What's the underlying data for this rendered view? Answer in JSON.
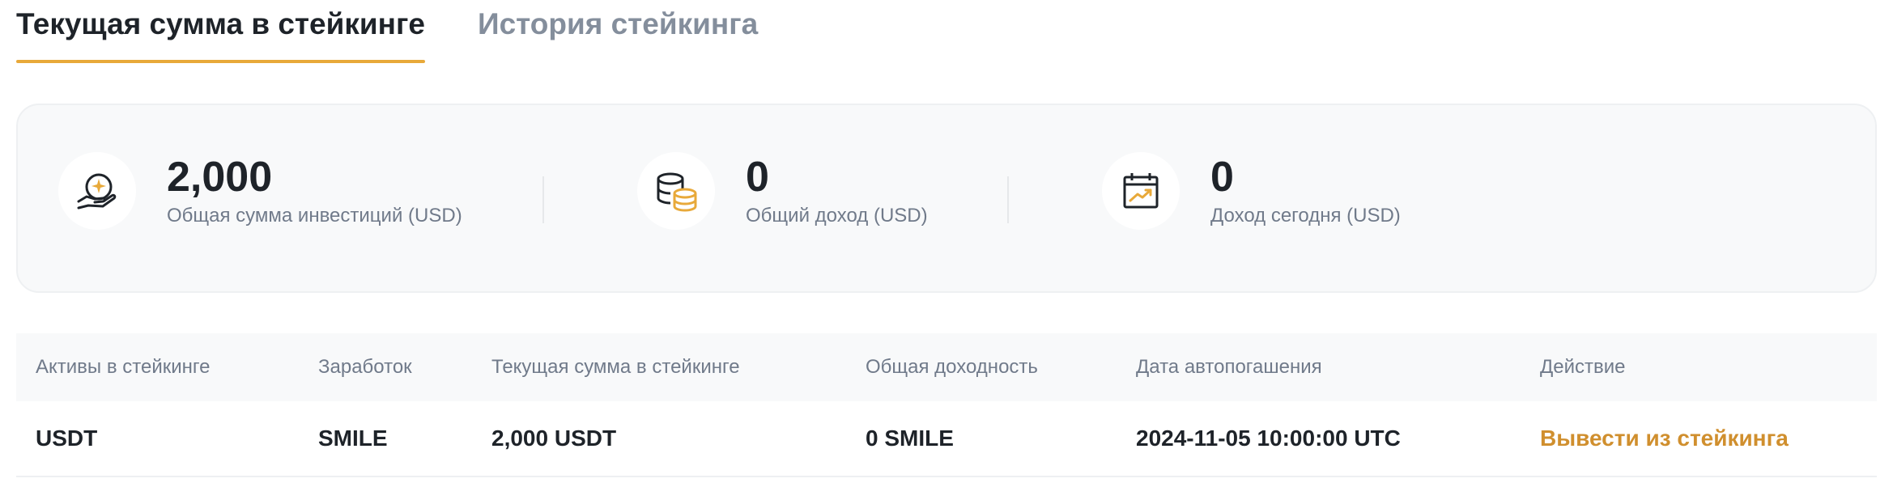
{
  "tabs": [
    {
      "label": "Текущая сумма в стейкинге",
      "active": true
    },
    {
      "label": "История стейкинга",
      "active": false
    }
  ],
  "summary": {
    "total_investment": {
      "value": "2,000",
      "label": "Общая сумма инвестиций (USD)",
      "icon": "hand-coin-icon"
    },
    "total_income": {
      "value": "0",
      "label": "Общий доход (USD)",
      "icon": "coin-stack-icon"
    },
    "today_income": {
      "value": "0",
      "label": "Доход сегодня (USD)",
      "icon": "calendar-chart-icon"
    }
  },
  "table": {
    "headers": [
      "Активы в стейкинге",
      "Заработок",
      "Текущая сумма в стейкинге",
      "Общая доходность",
      "Дата автопогашения",
      "Действие"
    ],
    "rows": [
      {
        "asset": "USDT",
        "earning": "SMILE",
        "current_amount": "2,000 USDT",
        "total_yield": "0 SMILE",
        "auto_redeem_date": "2024-11-05 10:00:00 UTC",
        "action": "Вывести из стейкинга"
      }
    ]
  },
  "colors": {
    "accent": "#e8a93a",
    "action_text": "#d08f2e",
    "text_primary": "#1e2329",
    "text_secondary": "#707a8a",
    "panel_bg": "#f8f9fa"
  }
}
